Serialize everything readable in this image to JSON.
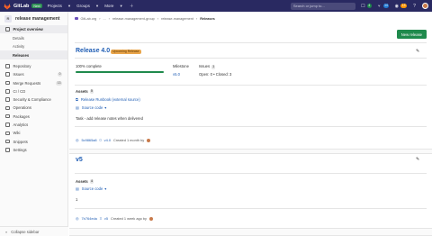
{
  "navbar": {
    "brand": "GitLab",
    "next_badge": "Next",
    "menu": [
      "Projects",
      "Groups",
      "More"
    ],
    "search_placeholder": "Search or jump to...",
    "counters": [
      {
        "value": "4",
        "color": "#1f8a4c"
      },
      {
        "value": "14",
        "color": "#1f78d1"
      },
      {
        "value": "13",
        "color": "#fc9403"
      }
    ]
  },
  "sidebar": {
    "project_initial": "R",
    "project_name": "release management",
    "overview": "Project overview",
    "overview_sub": [
      "Details",
      "Activity",
      "Releases"
    ],
    "items": [
      {
        "label": "Repository",
        "badge": ""
      },
      {
        "label": "Issues",
        "badge": "0"
      },
      {
        "label": "Merge Requests",
        "badge": "13"
      },
      {
        "label": "CI / CD",
        "badge": ""
      },
      {
        "label": "Security & Compliance",
        "badge": ""
      },
      {
        "label": "Operations",
        "badge": ""
      },
      {
        "label": "Packages",
        "badge": ""
      },
      {
        "label": "Analytics",
        "badge": ""
      },
      {
        "label": "Wiki",
        "badge": ""
      },
      {
        "label": "Snippets",
        "badge": ""
      },
      {
        "label": "Settings",
        "badge": ""
      }
    ],
    "collapse": "Collapse sidebar"
  },
  "breadcrumb": [
    "GitLab.org",
    "...",
    "release-management-group",
    "release-management"
  ],
  "breadcrumb_current": "Releases",
  "new_release": "New release",
  "releases": [
    {
      "title": "Release 4.0",
      "badge": "Upcoming Release",
      "progress_text": "100% complete",
      "progress": 1.0,
      "milestone_label": "Milestone",
      "milestone": "v5.0",
      "issues_label": "Issues",
      "issues_count": "3",
      "issues_state": "Open: 0 • Closed: 3",
      "assets_label": "Assets",
      "assets_count": "5",
      "runbook": "Release Runbook (external source)",
      "source_code": "Source code",
      "note": "Task - add release notes when delivered",
      "commit": "5c9865a8",
      "tag": "v4.0",
      "created": "Created 1 month by"
    },
    {
      "title": "v5",
      "assets_label": "Assets",
      "assets_count": "4",
      "source_code": "Source code",
      "note": "1",
      "commit": "7b764eda",
      "tag": "v5",
      "created": "Created 1 week ago by"
    }
  ]
}
